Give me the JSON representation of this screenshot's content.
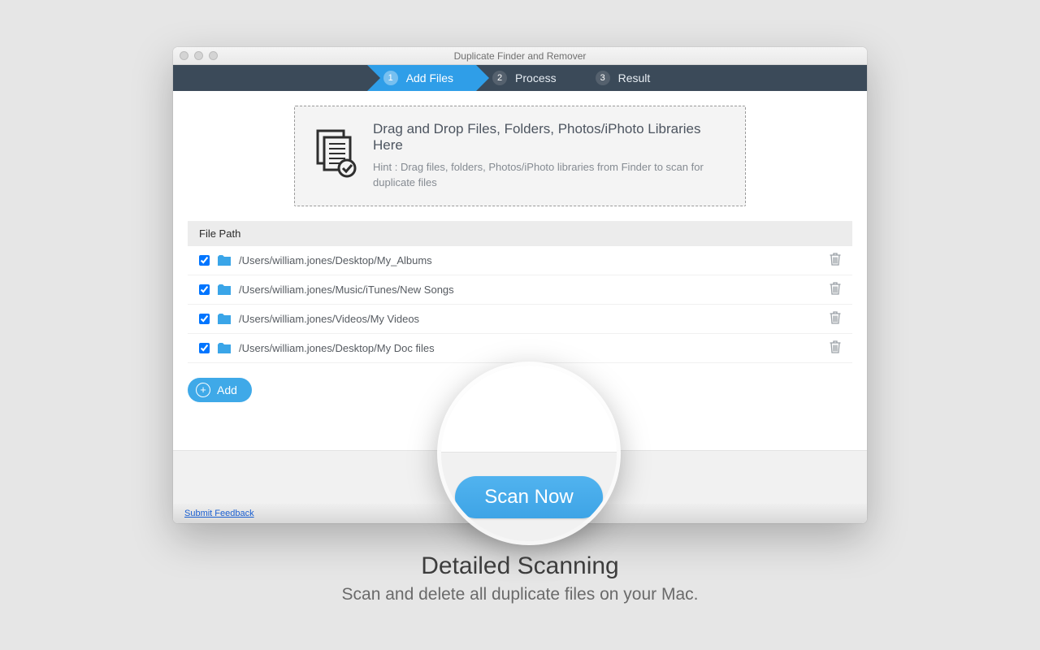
{
  "window": {
    "title": "Duplicate Finder and Remover"
  },
  "steps": [
    {
      "num": "1",
      "label": "Add Files"
    },
    {
      "num": "2",
      "label": "Process"
    },
    {
      "num": "3",
      "label": "Result"
    }
  ],
  "dropzone": {
    "title": "Drag and Drop Files, Folders, Photos/iPhoto Libraries Here",
    "hint": "Hint : Drag files, folders, Photos/iPhoto libraries from Finder to scan for duplicate files"
  },
  "table": {
    "header": "File Path",
    "rows": [
      {
        "path": "/Users/william.jones/Desktop/My_Albums",
        "checked": true
      },
      {
        "path": "/Users/william.jones/Music/iTunes/New Songs",
        "checked": true
      },
      {
        "path": "/Users/william.jones/Videos/My Videos",
        "checked": true
      },
      {
        "path": "/Users/william.jones/Desktop/My Doc files",
        "checked": true
      }
    ]
  },
  "buttons": {
    "add": "Add",
    "scan": "Scan Now",
    "scan_magnified": "Scan Now"
  },
  "footer": {
    "feedback": "Submit Feedback"
  },
  "caption": {
    "title": "Detailed Scanning",
    "subtitle": "Scan and delete all duplicate files on your Mac."
  }
}
